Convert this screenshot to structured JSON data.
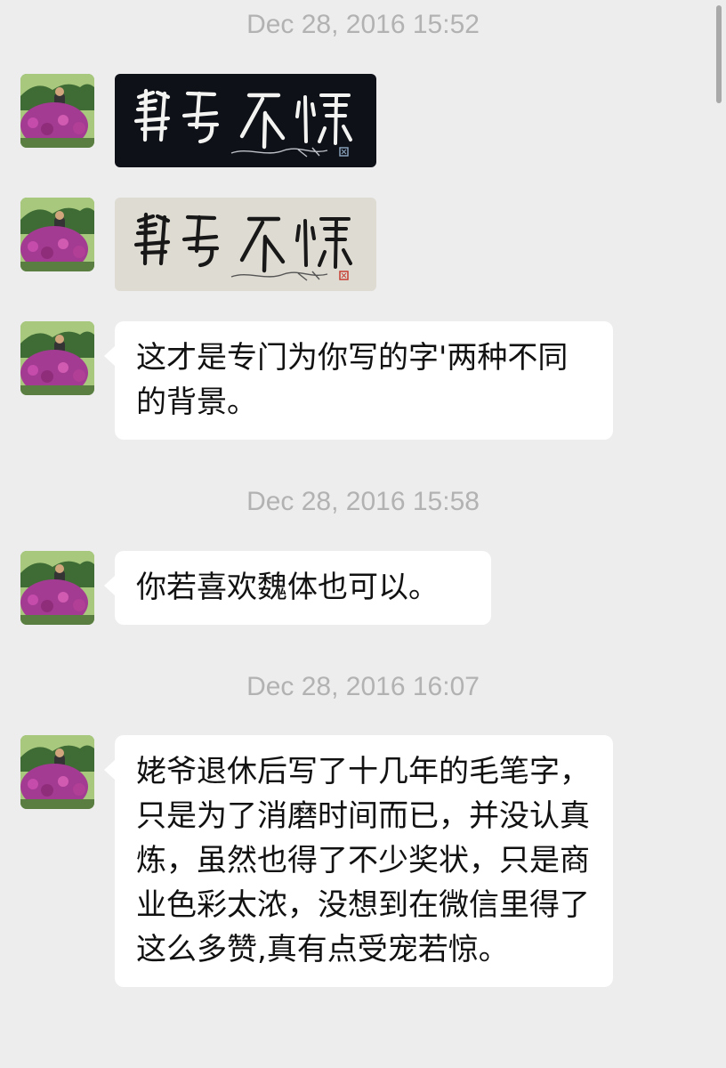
{
  "chat": {
    "timestamps": [
      "Dec 28, 2016 15:52",
      "Dec 28, 2016 15:58",
      "Dec 28, 2016 16:07"
    ],
    "messages": [
      {
        "type": "image",
        "variant": "dark",
        "calligraphy": "龍辱不惊"
      },
      {
        "type": "image",
        "variant": "light",
        "calligraphy": "龍辱不惊"
      },
      {
        "type": "text",
        "text": "这才是专门为你写的字'两种不同的背景。"
      },
      {
        "type": "text",
        "text": "你若喜欢魏体也可以。"
      },
      {
        "type": "text",
        "text": "姥爷退休后写了十几年的毛笔字，只是为了消磨时间而已，并没认真炼，虽然也得了不少奖状，只是商业色彩太浓，没想到在微信里得了这么多赞,真有点受宠若惊。"
      }
    ]
  },
  "colors": {
    "background": "#ededed",
    "bubble": "#ffffff",
    "timestamp": "#b2b2b2",
    "dark_image": "#0f1118",
    "light_image": "#dedbd2"
  }
}
